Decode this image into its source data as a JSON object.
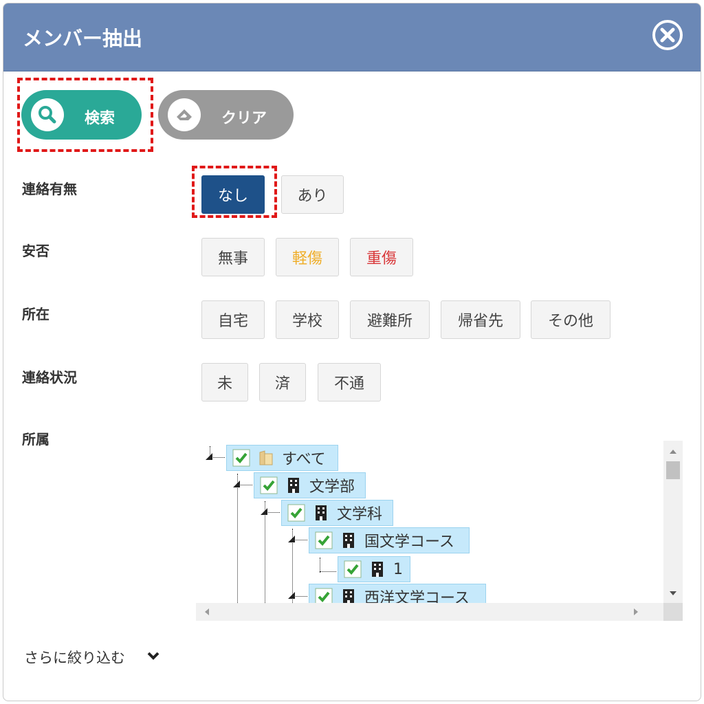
{
  "modal": {
    "title": "メンバー抽出"
  },
  "toolbar": {
    "search_label": "検索",
    "clear_label": "クリア"
  },
  "filters": {
    "contact": {
      "label": "連絡有無",
      "options": [
        "なし",
        "あり"
      ],
      "selected": "なし"
    },
    "safety": {
      "label": "安否",
      "options": [
        "無事",
        "軽傷",
        "重傷"
      ]
    },
    "location": {
      "label": "所在",
      "options": [
        "自宅",
        "学校",
        "避難所",
        "帰省先",
        "その他"
      ]
    },
    "contact_status": {
      "label": "連絡状況",
      "options": [
        "未",
        "済",
        "不通"
      ]
    },
    "affiliation": {
      "label": "所属",
      "tree": [
        {
          "label": "すべて",
          "icon": "folder-icon",
          "checked": true
        },
        {
          "label": "文学部",
          "icon": "building-icon",
          "checked": true
        },
        {
          "label": "文学科",
          "icon": "building-icon",
          "checked": true
        },
        {
          "label": "国文学コース",
          "icon": "building-icon",
          "checked": true
        },
        {
          "label": "1",
          "icon": "building-icon",
          "checked": true
        },
        {
          "label": "西洋文学コース",
          "icon": "building-icon",
          "checked": true
        }
      ]
    }
  },
  "more_filters": {
    "label": "さらに絞り込む"
  },
  "colors": {
    "header": "#6b88b6",
    "search": "#2aa997",
    "clear": "#9a9a9a",
    "selected": "#1e5189",
    "minor_injury": "#efae2a",
    "serious_injury": "#d9383a",
    "highlight": "#e01818"
  }
}
